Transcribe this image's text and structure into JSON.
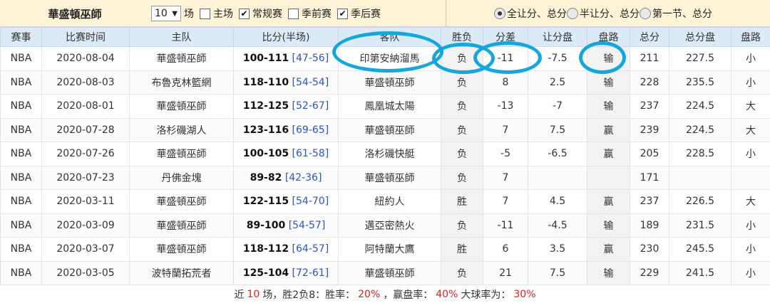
{
  "filter": {
    "team": "華盛頓巫師",
    "count_value": "10",
    "count_unit": "场",
    "home_label": "主场",
    "regular_label": "常规赛",
    "preseason_label": "季前赛",
    "playoffs_label": "季后赛",
    "home_checked": false,
    "regular_checked": true,
    "preseason_checked": false,
    "playoffs_checked": true,
    "radio_full": "全让分、总分",
    "radio_half": "半让分、总分",
    "radio_q1": "第一节、总分",
    "radio_selected": "full"
  },
  "headers": [
    "赛事",
    "比赛时间",
    "主队",
    "比分(半场)",
    "客队",
    "胜负",
    "分差",
    "让分盘",
    "盘路",
    "总分",
    "总分盘",
    "盘路"
  ],
  "rows": [
    {
      "league": "NBA",
      "date": "2020-08-04",
      "home": "華盛頓巫師",
      "score": "100-111",
      "half": "[47-56]",
      "away": "印第安納溜馬",
      "result": "负",
      "diff": "-11",
      "spread": "-7.5",
      "spread_res": "输",
      "total": "211",
      "total_line": "227.5",
      "ou": "小"
    },
    {
      "league": "NBA",
      "date": "2020-08-03",
      "home": "布魯克林籃網",
      "score": "118-110",
      "half": "[54-54]",
      "away": "華盛頓巫師",
      "result": "负",
      "diff": "8",
      "spread": "2.5",
      "spread_res": "输",
      "total": "228",
      "total_line": "235.5",
      "ou": "小"
    },
    {
      "league": "NBA",
      "date": "2020-08-01",
      "home": "華盛頓巫師",
      "score": "112-125",
      "half": "[52-67]",
      "away": "鳳凰城太陽",
      "result": "负",
      "diff": "-13",
      "spread": "-7",
      "spread_res": "输",
      "total": "237",
      "total_line": "224.5",
      "ou": "大"
    },
    {
      "league": "NBA",
      "date": "2020-07-28",
      "home": "洛杉磯湖人",
      "score": "123-116",
      "half": "[69-65]",
      "away": "華盛頓巫師",
      "result": "负",
      "diff": "7",
      "spread": "7.5",
      "spread_res": "赢",
      "total": "239",
      "total_line": "224.5",
      "ou": "大"
    },
    {
      "league": "NBA",
      "date": "2020-07-26",
      "home": "華盛頓巫師",
      "score": "100-105",
      "half": "[61-58]",
      "away": "洛杉磯快艇",
      "result": "负",
      "diff": "-5",
      "spread": "-6.5",
      "spread_res": "赢",
      "total": "205",
      "total_line": "228.5",
      "ou": "小"
    },
    {
      "league": "NBA",
      "date": "2020-07-23",
      "home": "丹佛金塊",
      "score": "89-82",
      "half": "[42-36]",
      "away": "華盛頓巫師",
      "result": "负",
      "diff": "7",
      "spread": "",
      "spread_res": "",
      "total": "171",
      "total_line": "",
      "ou": ""
    },
    {
      "league": "NBA",
      "date": "2020-03-11",
      "home": "華盛頓巫師",
      "score": "122-115",
      "half": "[54-70]",
      "away": "紐約人",
      "result": "胜",
      "diff": "7",
      "spread": "4.5",
      "spread_res": "赢",
      "total": "237",
      "total_line": "226.5",
      "ou": "大"
    },
    {
      "league": "NBA",
      "date": "2020-03-09",
      "home": "華盛頓巫師",
      "score": "89-100",
      "half": "[54-57]",
      "away": "邁亞密熱火",
      "result": "负",
      "diff": "-11",
      "spread": "-4.5",
      "spread_res": "输",
      "total": "189",
      "total_line": "231.5",
      "ou": "小"
    },
    {
      "league": "NBA",
      "date": "2020-03-07",
      "home": "華盛頓巫師",
      "score": "118-112",
      "half": "[64-57]",
      "away": "阿特蘭大鷹",
      "result": "胜",
      "diff": "6",
      "spread": "3.5",
      "spread_res": "赢",
      "total": "230",
      "total_line": "245.5",
      "ou": "小"
    },
    {
      "league": "NBA",
      "date": "2020-03-05",
      "home": "波特蘭拓荒者",
      "score": "125-104",
      "half": "[72-61]",
      "away": "華盛頓巫師",
      "result": "负",
      "diff": "21",
      "spread": "7.5",
      "spread_res": "输",
      "total": "229",
      "total_line": "241.5",
      "ou": "小"
    }
  ],
  "highlight_team": "華盛頓巫師",
  "summary": {
    "prefix": "近",
    "count": "10",
    "mid": "场，胜2负8：胜率：",
    "win_rate": "20%",
    "cover_label": "，赢盘率：",
    "cover_rate": "40%",
    "over_label": " 大球率为：",
    "over_rate": "30%"
  },
  "colors": {
    "header_bg": "#dce9f7",
    "filter_bg": "#fdf3d6",
    "green": "#2a8a2a",
    "red": "#e02020",
    "blue": "#1a32b4",
    "annotation": "#15a6dc"
  }
}
